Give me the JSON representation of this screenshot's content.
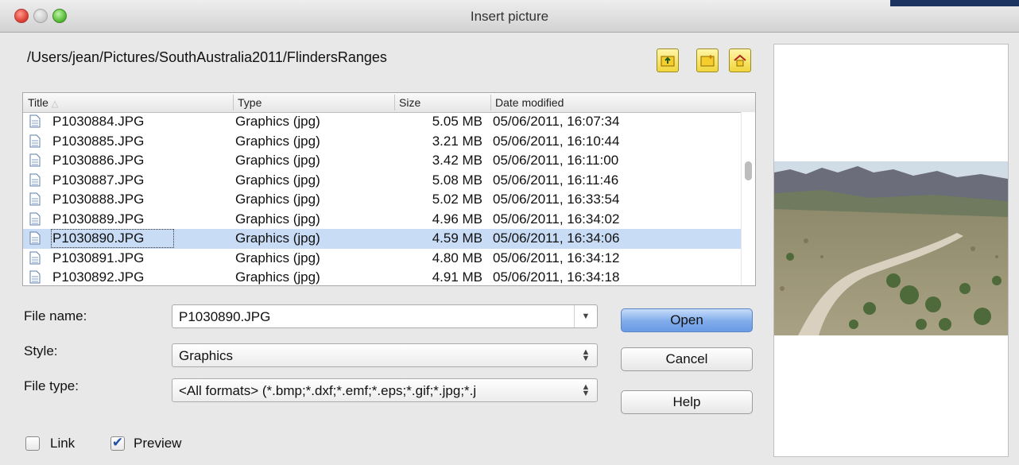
{
  "window": {
    "title": "Insert picture"
  },
  "path": "/Users/jean/Pictures/SouthAustralia2011/FlindersRanges",
  "toolbar": {
    "up_icon": "folder-up-icon",
    "new_folder_icon": "new-folder-icon",
    "home_icon": "home-icon"
  },
  "file_list": {
    "columns": {
      "title": "Title",
      "type": "Type",
      "size": "Size",
      "date": "Date modified"
    },
    "rows": [
      {
        "name": "P1030884.JPG",
        "type": "Graphics (jpg)",
        "size": "5.05 MB",
        "date": "05/06/2011, 16:07:34"
      },
      {
        "name": "P1030885.JPG",
        "type": "Graphics (jpg)",
        "size": "3.21 MB",
        "date": "05/06/2011, 16:10:44"
      },
      {
        "name": "P1030886.JPG",
        "type": "Graphics (jpg)",
        "size": "3.42 MB",
        "date": "05/06/2011, 16:11:00"
      },
      {
        "name": "P1030887.JPG",
        "type": "Graphics (jpg)",
        "size": "5.08 MB",
        "date": "05/06/2011, 16:11:46"
      },
      {
        "name": "P1030888.JPG",
        "type": "Graphics (jpg)",
        "size": "5.02 MB",
        "date": "05/06/2011, 16:33:54"
      },
      {
        "name": "P1030889.JPG",
        "type": "Graphics (jpg)",
        "size": "4.96 MB",
        "date": "05/06/2011, 16:34:02"
      },
      {
        "name": "P1030890.JPG",
        "type": "Graphics (jpg)",
        "size": "4.59 MB",
        "date": "05/06/2011, 16:34:06"
      },
      {
        "name": "P1030891.JPG",
        "type": "Graphics (jpg)",
        "size": "4.80 MB",
        "date": "05/06/2011, 16:34:12"
      },
      {
        "name": "P1030892.JPG",
        "type": "Graphics (jpg)",
        "size": "4.91 MB",
        "date": "05/06/2011, 16:34:18"
      }
    ]
  },
  "form": {
    "file_name_label": "File name:",
    "file_name_value": "P1030890.JPG",
    "style_label": "Style:",
    "style_value": "Graphics",
    "file_type_label": "File type:",
    "file_type_value": "<All formats> (*.bmp;*.dxf;*.emf;*.eps;*.gif;*.jpg;*.j"
  },
  "buttons": {
    "open": "Open",
    "cancel": "Cancel",
    "help": "Help"
  },
  "options": {
    "link_label": "Link",
    "link_checked": false,
    "preview_label": "Preview",
    "preview_checked": true
  },
  "colors": {
    "selection": "#c9dcf5",
    "default_button": "#7fabeb"
  }
}
